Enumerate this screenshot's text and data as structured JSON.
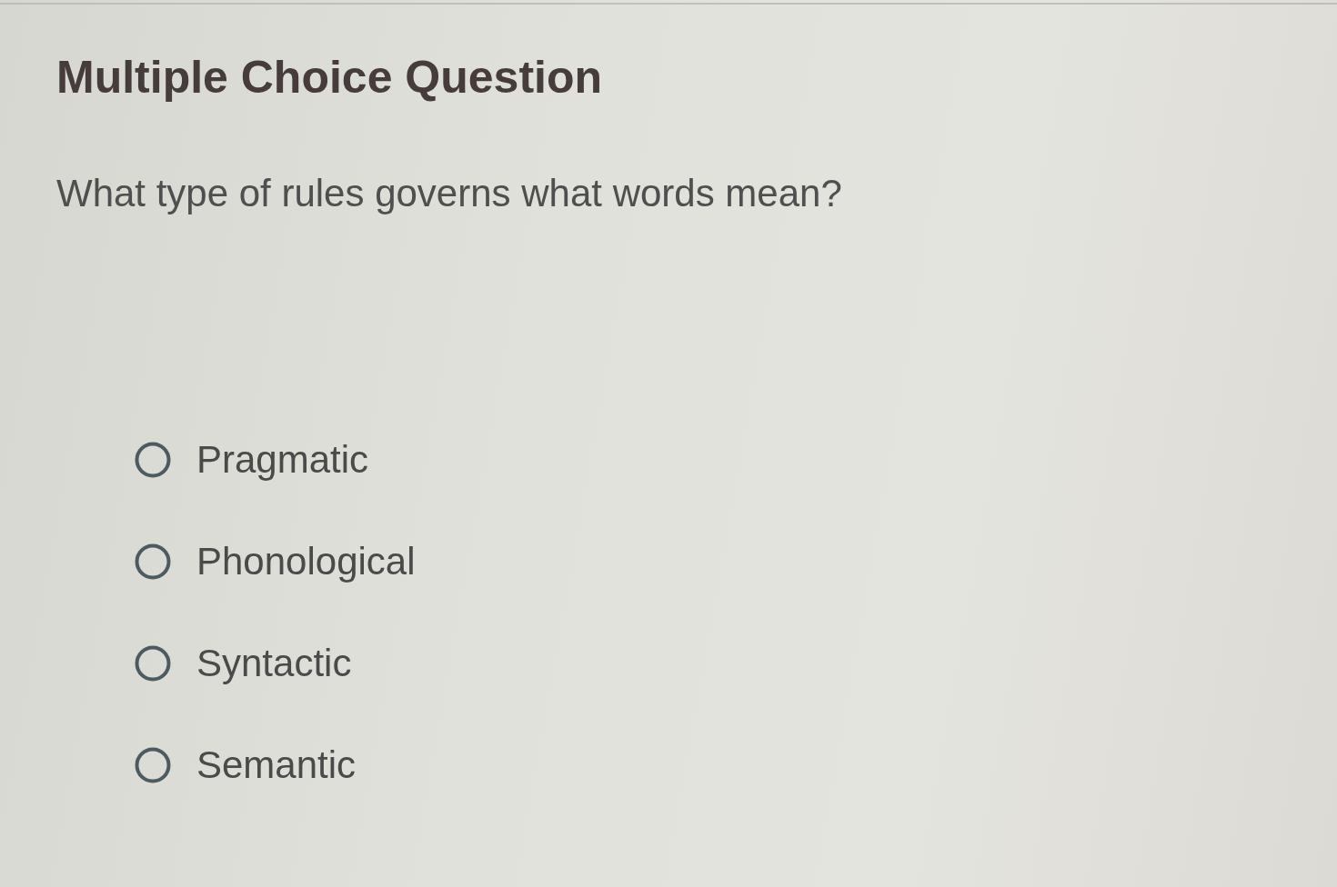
{
  "header": {
    "title": "Multiple Choice Question"
  },
  "question": {
    "text": "What type of rules governs what words mean?"
  },
  "options": [
    {
      "label": "Pragmatic",
      "selected": false
    },
    {
      "label": "Phonological",
      "selected": false
    },
    {
      "label": "Syntactic",
      "selected": false
    },
    {
      "label": "Semantic",
      "selected": false
    }
  ]
}
